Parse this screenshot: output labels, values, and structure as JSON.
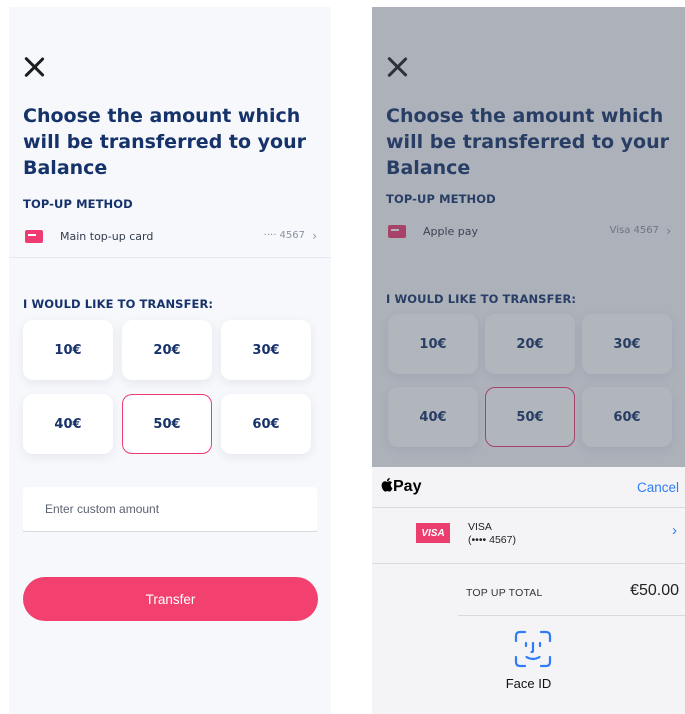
{
  "left": {
    "title": "Choose the amount which will be transferred to your Balance",
    "method_label": "TOP-UP METHOD",
    "method": {
      "name": "Main top-up card",
      "meta": "···· 4567"
    },
    "transfer_label": "I WOULD LIKE TO TRANSFER:",
    "amounts": [
      "10€",
      "20€",
      "30€",
      "40€",
      "50€",
      "60€"
    ],
    "selected_amount": "50€",
    "custom_placeholder": "Enter custom amount",
    "transfer_button": "Transfer"
  },
  "right": {
    "title": "Choose the amount which will be transferred to your Balance",
    "method_label": "TOP-UP METHOD",
    "method": {
      "name": "Apple pay",
      "meta": "Visa 4567"
    },
    "transfer_label": "I WOULD LIKE TO TRANSFER:",
    "amounts": [
      "10€",
      "20€",
      "30€",
      "40€",
      "50€",
      "60€"
    ],
    "selected_amount": "50€",
    "pay_sheet": {
      "logo": "Pay",
      "cancel": "Cancel",
      "card_badge": "VISA",
      "card_name": "VISA",
      "card_number": "(•••• 4567)",
      "total_label": "TOP UP TOTAL",
      "total_value": "€50.00",
      "auth_label": "Face ID"
    }
  },
  "colors": {
    "accent": "#f2416f",
    "navy": "#16326a",
    "ios_blue": "#2f7cf6"
  },
  "icons": [
    "close-icon",
    "card-icon",
    "chevron-right-icon",
    "apple-icon",
    "face-id-icon"
  ]
}
